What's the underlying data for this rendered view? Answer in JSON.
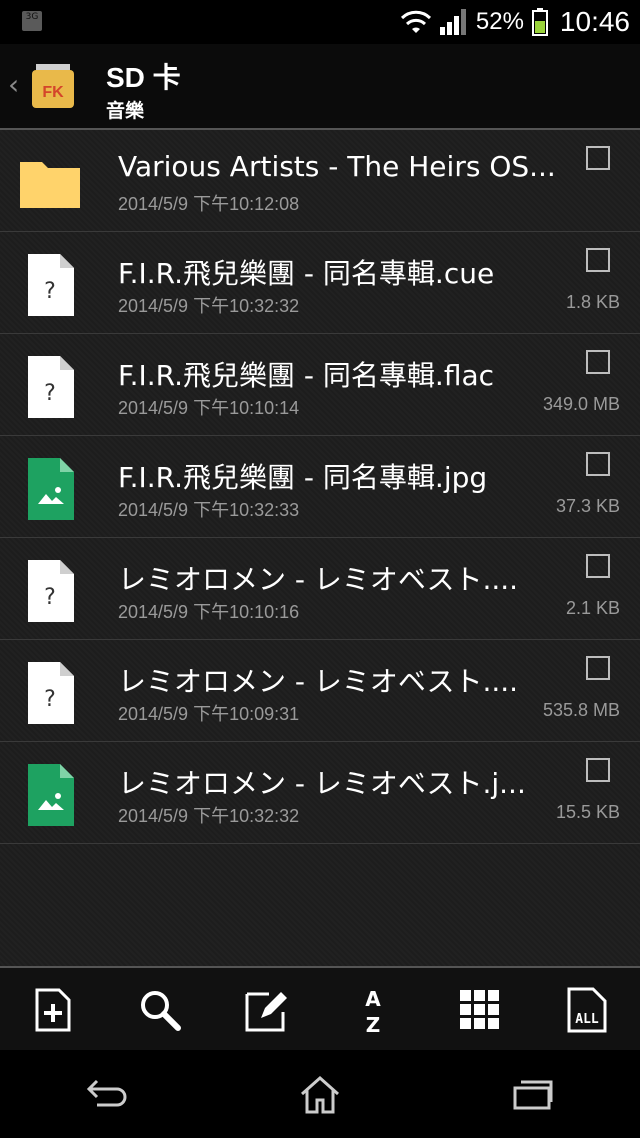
{
  "status_bar": {
    "network": "3G",
    "battery_percent": "52%",
    "time": "10:46",
    "icons": [
      "wifi-icon",
      "signal-icon",
      "battery-icon"
    ]
  },
  "header": {
    "title": "SD 卡",
    "subtitle": "音樂",
    "logo_text": "FK"
  },
  "files": [
    {
      "name": "Various Artists - The Heirs OS...",
      "date": "2014/5/9 下午10:12:08",
      "size": "",
      "icon": "folder-icon"
    },
    {
      "name": "F.I.R.飛兒樂團 - 同名專輯.cue",
      "date": "2014/5/9 下午10:32:32",
      "size": "1.8 KB",
      "icon": "unknown-file-icon"
    },
    {
      "name": "F.I.R.飛兒樂團 - 同名專輯.flac",
      "date": "2014/5/9 下午10:10:14",
      "size": "349.0 MB",
      "icon": "unknown-file-icon"
    },
    {
      "name": "F.I.R.飛兒樂團 - 同名專輯.jpg",
      "date": "2014/5/9 下午10:32:33",
      "size": "37.3 KB",
      "icon": "image-file-icon"
    },
    {
      "name": "レミオロメン - レミオベスト....",
      "date": "2014/5/9 下午10:10:16",
      "size": "2.1 KB",
      "icon": "unknown-file-icon"
    },
    {
      "name": "レミオロメン - レミオベスト....",
      "date": "2014/5/9 下午10:09:31",
      "size": "535.8 MB",
      "icon": "unknown-file-icon"
    },
    {
      "name": "レミオロメン - レミオベスト.j...",
      "date": "2014/5/9 下午10:32:32",
      "size": "15.5 KB",
      "icon": "image-file-icon"
    }
  ],
  "toolbar": {
    "items": [
      "new-file-icon",
      "search-icon",
      "edit-icon",
      "sort-az-icon",
      "grid-view-icon",
      "select-all-icon"
    ],
    "sort_top": "A",
    "sort_bottom": "Z",
    "select_all_text": "ALL"
  },
  "navbar": {
    "items": [
      "back-icon",
      "home-icon",
      "recent-apps-icon"
    ]
  },
  "colors": {
    "folder": "#ffd36b",
    "image_file": "#1ea261",
    "logo_bg": "#e9b94a",
    "logo_text": "#d4452a"
  }
}
